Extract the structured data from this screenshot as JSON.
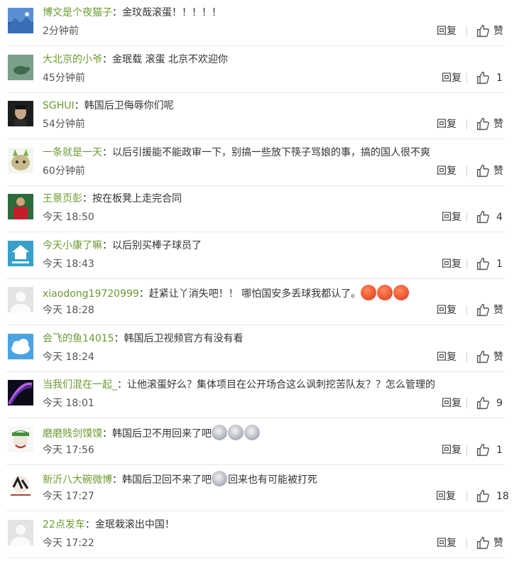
{
  "labels": {
    "reply": "回复"
  },
  "colors": {
    "username": "#6a9b2f",
    "text": "#333333",
    "meta": "#555555",
    "divider": "#e8e8e8"
  },
  "comments": [
    {
      "user": "博文是个夜猫子",
      "sep": "：",
      "text": "金玟哉滚蛋！！！！！",
      "emoji": [],
      "time": "2分钟前",
      "likes": "赞",
      "avatar": "blue-mountain"
    },
    {
      "user": "大北京的小爷",
      "sep": "：",
      "text": "金珉载 滚蛋 北京不欢迎你",
      "emoji": [],
      "time": "45分钟前",
      "likes": "1",
      "avatar": "green-turtle"
    },
    {
      "user": "SGHUI",
      "sep": "：",
      "text": "韩国后卫侮辱你们呢",
      "emoji": [],
      "time": "54分钟前",
      "likes": "赞",
      "avatar": "dark-portrait"
    },
    {
      "user": "一条就是一天",
      "sep": "：",
      "text": "以后引援能不能政审一下，别搞一些放下筷子骂娘的事，搞的国人很不爽",
      "emoji": [],
      "time": "60分钟前",
      "likes": "赞",
      "avatar": "cartoon-cat"
    },
    {
      "user": "王景页彭",
      "sep": "：",
      "text": "按在板凳上走完合同",
      "emoji": [],
      "time": "今天 18:50",
      "likes": "4",
      "avatar": "red-jersey"
    },
    {
      "user": "今天小康了嘛",
      "sep": "：",
      "text": "以后别买棒子球员了",
      "emoji": [],
      "time": "今天 18:43",
      "likes": "1",
      "avatar": "stay-home-logo"
    },
    {
      "user": "xiaodong19720999",
      "sep": "：",
      "text": "赶紧让丫消失吧！！ 哪怕国安多丢球我都认了。",
      "emoji": [
        "angry-emoji",
        "angry-emoji",
        "angry-emoji"
      ],
      "time": "今天 18:28",
      "likes": "赞",
      "avatar": "default-gray"
    },
    {
      "user": "会飞的鱼14015",
      "sep": "：",
      "text": "韩国后卫视频官方有没有看",
      "emoji": [],
      "time": "今天 18:24",
      "likes": "赞",
      "avatar": "blue-cloud"
    },
    {
      "user": "当我们混在一起_",
      "sep": "：",
      "text": "让他滚蛋好么？集体项目在公开场合这么讽刺挖苦队友？？怎么管理的",
      "emoji": [],
      "time": "今天 18:01",
      "likes": "9",
      "avatar": "purple-space"
    },
    {
      "user": "磨磨贱剑馍馍",
      "sep": "：",
      "text": "韩国后卫不用回来了吧",
      "emoji": [
        "fish-face-emoji",
        "fish-face-emoji",
        "fish-face-emoji"
      ],
      "time": "今天 17:56",
      "likes": "1",
      "avatar": "joker"
    },
    {
      "user": "新沂八大碗微博",
      "sep": "：",
      "text": "韩国后卫回不来了吧",
      "emoji": [
        "fish-face-emoji"
      ],
      "text2": "回来也有可能被打死",
      "time": "今天 17:27",
      "likes": "18",
      "avatar": "calligraphy-logo"
    },
    {
      "user": "22点发车",
      "sep": "：",
      "text": "金珉栽滚出中国！",
      "emoji": [],
      "time": "今天 17:22",
      "likes": "赞",
      "avatar": "default-gray"
    }
  ]
}
